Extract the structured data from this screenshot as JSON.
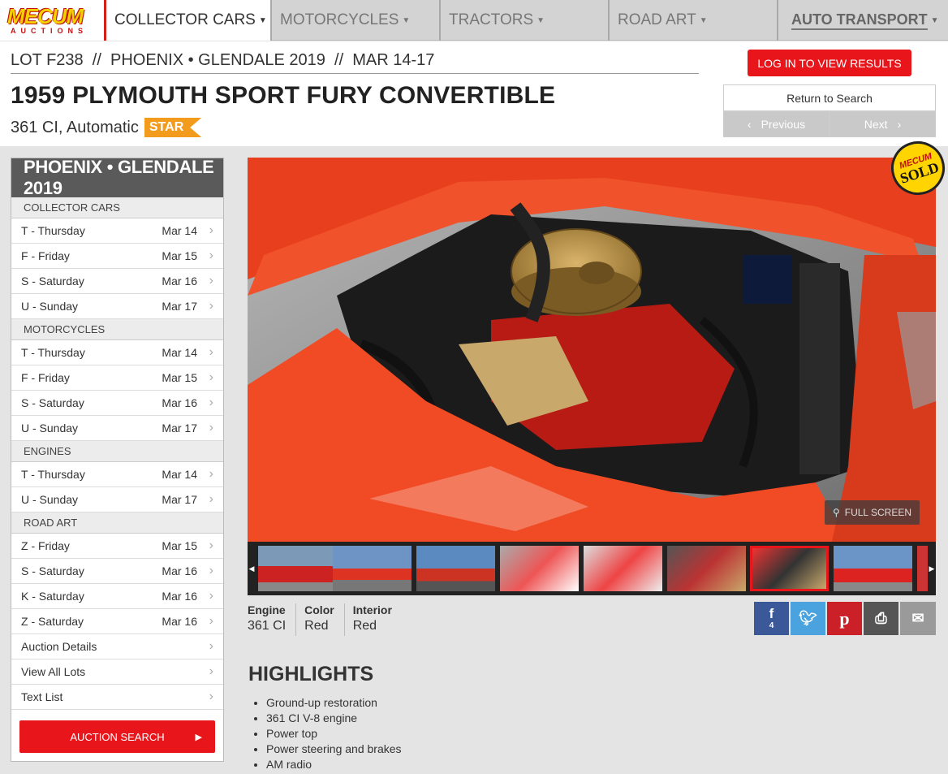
{
  "logo": {
    "top": "MECUM",
    "bottom": "AUCTIONS"
  },
  "nav": {
    "tabs": [
      {
        "label": "COLLECTOR CARS",
        "active": true
      },
      {
        "label": "MOTORCYCLES",
        "active": false
      },
      {
        "label": "TRACTORS",
        "active": false
      },
      {
        "label": "ROAD ART",
        "active": false
      },
      {
        "label": "AUTO TRANSPORT",
        "active": false
      }
    ]
  },
  "header": {
    "lot_line": "LOT F238  //  PHOENIX • GLENDALE 2019  //  MAR 14-17",
    "title": "1959 PLYMOUTH SPORT FURY CONVERTIBLE",
    "subtitle": "361 CI, Automatic",
    "badge": "STAR",
    "login_label": "LOG IN TO VIEW RESULTS",
    "return_label": "Return to Search",
    "prev_label": "Previous",
    "next_label": "Next"
  },
  "sidebar": {
    "title": "PHOENIX • GLENDALE 2019",
    "sections": [
      {
        "name": "COLLECTOR CARS",
        "rows": [
          {
            "day": "T - Thursday",
            "date": "Mar 14"
          },
          {
            "day": "F - Friday",
            "date": "Mar 15"
          },
          {
            "day": "S - Saturday",
            "date": "Mar 16"
          },
          {
            "day": "U - Sunday",
            "date": "Mar 17"
          }
        ]
      },
      {
        "name": "MOTORCYCLES",
        "rows": [
          {
            "day": "T - Thursday",
            "date": "Mar 14"
          },
          {
            "day": "F - Friday",
            "date": "Mar 15"
          },
          {
            "day": "S - Saturday",
            "date": "Mar 16"
          },
          {
            "day": "U - Sunday",
            "date": "Mar 17"
          }
        ]
      },
      {
        "name": "ENGINES",
        "rows": [
          {
            "day": "T - Thursday",
            "date": "Mar 14"
          },
          {
            "day": "U - Sunday",
            "date": "Mar 17"
          }
        ]
      },
      {
        "name": "ROAD ART",
        "rows": [
          {
            "day": "Z - Friday",
            "date": "Mar 15"
          },
          {
            "day": "S - Saturday",
            "date": "Mar 16"
          },
          {
            "day": "K - Saturday",
            "date": "Mar 16"
          },
          {
            "day": "Z - Saturday",
            "date": "Mar 16"
          }
        ]
      }
    ],
    "footer_links": [
      "Auction Details",
      "View All Lots",
      "Text List"
    ],
    "search_button": "AUCTION SEARCH"
  },
  "photo": {
    "sold_badge_top": "MECUM",
    "sold_badge_bottom": "SOLD",
    "fullscreen_label": "FULL SCREEN"
  },
  "thumbnails": {
    "count": 9,
    "active_index": 6
  },
  "specs": [
    {
      "label": "Engine",
      "value": "361 CI"
    },
    {
      "label": "Color",
      "value": "Red"
    },
    {
      "label": "Interior",
      "value": "Red"
    }
  ],
  "share": {
    "facebook_count": "4",
    "colors": {
      "facebook": "#3b5998",
      "twitter": "#4aa3df",
      "pinterest": "#cb2027",
      "print": "#555555",
      "email": "#9a9a9a"
    }
  },
  "highlights": {
    "title": "HIGHLIGHTS",
    "items": [
      "Ground-up restoration",
      "361 CI V-8 engine",
      "Power top",
      "Power steering and brakes",
      "AM radio"
    ]
  },
  "colors": {
    "accent_red": "#e8161b",
    "star_orange": "#f29b1d",
    "sidebar_header": "#5a5a5a"
  }
}
